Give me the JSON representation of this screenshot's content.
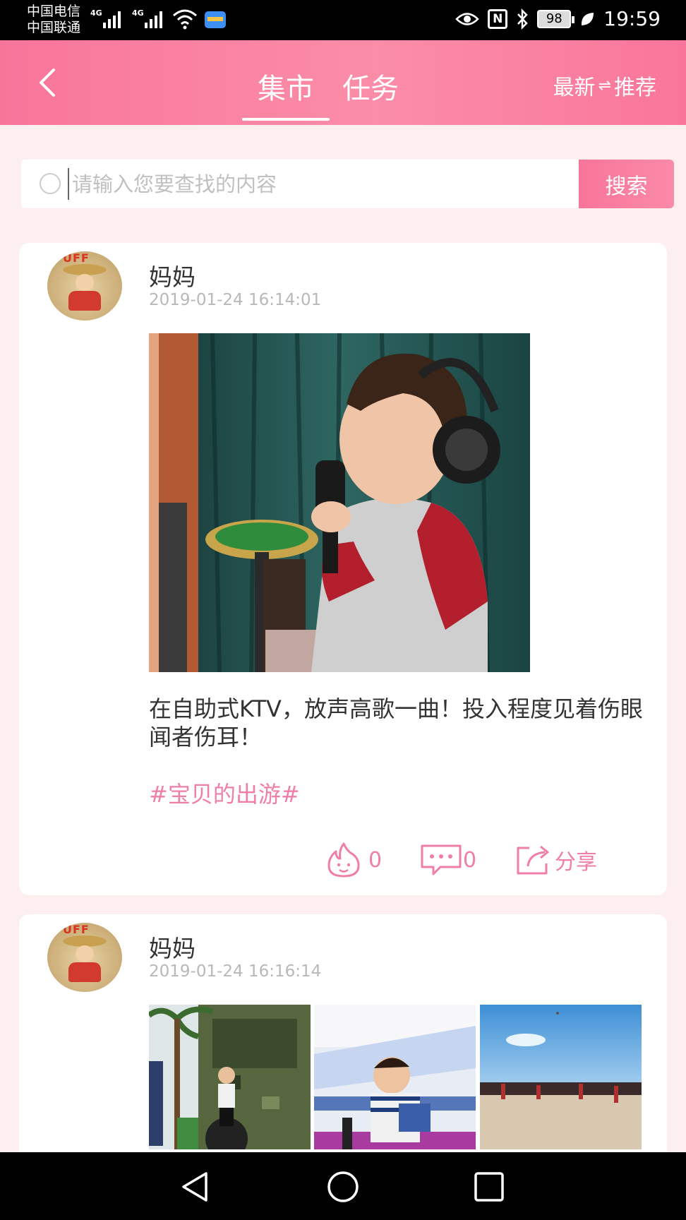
{
  "status_bar": {
    "carrier1": "中国电信",
    "carrier2": "中国联通",
    "network1": "4G",
    "network2": "4G",
    "nfc": "N",
    "battery": "98",
    "time": "19:59"
  },
  "header": {
    "tabs": [
      {
        "label": "集市",
        "active": true
      },
      {
        "label": "任务",
        "active": false
      }
    ],
    "sort_left": "最新",
    "sort_swap": "⇌",
    "sort_right": "推荐"
  },
  "search": {
    "placeholder": "请输入您要查找的内容",
    "value": "",
    "button": "搜索"
  },
  "posts": [
    {
      "username": "妈妈",
      "timestamp": "2019-01-24 16:14:01",
      "text": "在自助式KTV，放声高歌一曲！投入程度见着伤眼闻者伤耳！",
      "hashtag": "#宝贝的出游#",
      "likes": "0",
      "comments": "0",
      "share_label": "分享"
    },
    {
      "username": "妈妈",
      "timestamp": "2019-01-24 16:16:14"
    }
  ],
  "colors": {
    "accent": "#f8759a",
    "accent_text": "#ef7fa8",
    "background": "#fdeef0"
  }
}
